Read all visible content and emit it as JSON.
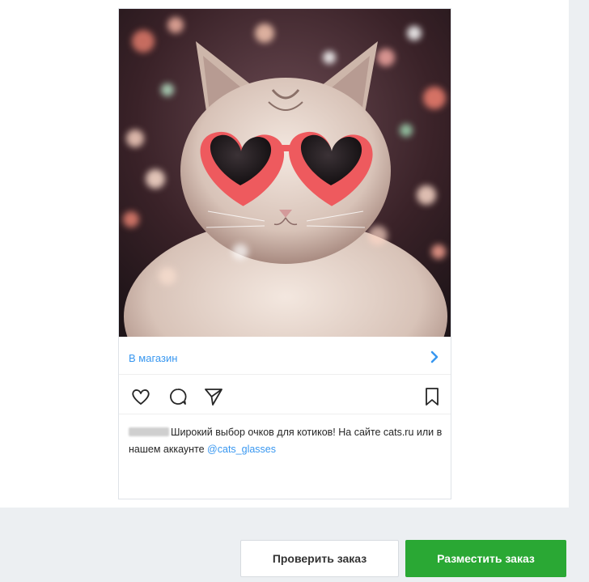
{
  "post": {
    "image": {
      "subject": "cat-in-heart-sunglasses"
    },
    "shop_link": "В магазин",
    "caption": {
      "text": "Широкий выбор очков для котиков! На сайте cats.ru или в нашем аккаунте ",
      "mention": "@cats_glasses"
    },
    "icons": [
      "heart-icon",
      "comment-icon",
      "share-icon",
      "bookmark-icon",
      "chevron-right-icon"
    ]
  },
  "footer": {
    "check_button": "Проверить заказ",
    "place_button": "Разместить заказ"
  },
  "colors": {
    "link": "#3897f0",
    "primary_button": "#2aa834",
    "panel_bg": "#eceff2"
  }
}
